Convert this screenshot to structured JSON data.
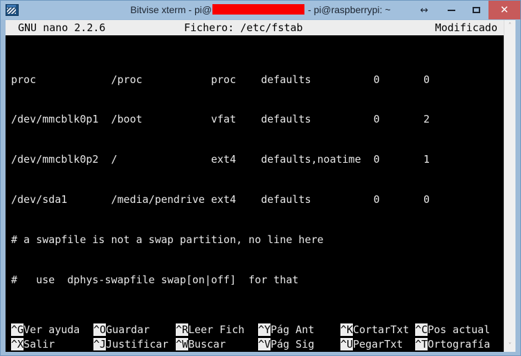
{
  "window": {
    "title_prefix": "Bitvise xterm - pi@",
    "title_suffix": " - pi@raspberrypi: ~",
    "icon": "terminal-app-icon",
    "buttons": {
      "resize": "↔",
      "minimize": "minimize",
      "maximize": "maximize",
      "close": "✕"
    },
    "close_color": "#c75a5a",
    "titlebar_color": "#a2c0dd",
    "redaction_color": "#f90000"
  },
  "editor": {
    "header": {
      "version": "GNU nano 2.2.6",
      "file_label": "Fichero: /etc/fstab",
      "status": "Modificado"
    },
    "lines": [
      "proc            /proc           proc    defaults          0       0",
      "/dev/mmcblk0p1  /boot           vfat    defaults          0       2",
      "/dev/mmcblk0p2  /               ext4    defaults,noatime  0       1",
      "/dev/sda1       /media/pendrive ext4    defaults          0       0",
      "# a swapfile is not a swap partition, no line here",
      "#   use  dphys-swapfile swap[on|off]  for that"
    ],
    "shortcuts_row1": [
      {
        "key": "^G",
        "label": "Ver ayuda"
      },
      {
        "key": "^O",
        "label": "Guardar"
      },
      {
        "key": "^R",
        "label": "Leer Fich"
      },
      {
        "key": "^Y",
        "label": "Pág Ant"
      },
      {
        "key": "^K",
        "label": "CortarTxt"
      },
      {
        "key": "^C",
        "label": "Pos actual"
      }
    ],
    "shortcuts_row2": [
      {
        "key": "^X",
        "label": "Salir"
      },
      {
        "key": "^J",
        "label": "Justificar"
      },
      {
        "key": "^W",
        "label": "Buscar"
      },
      {
        "key": "^V",
        "label": "Pág Sig"
      },
      {
        "key": "^U",
        "label": "PegarTxt"
      },
      {
        "key": "^T",
        "label": "Ortografía"
      }
    ],
    "foreground": "#e8e8e8",
    "background": "#000000",
    "inverse_background": "#ededed"
  },
  "scrollbar": {
    "up_arrow": "˄",
    "down_arrow": "˅"
  }
}
